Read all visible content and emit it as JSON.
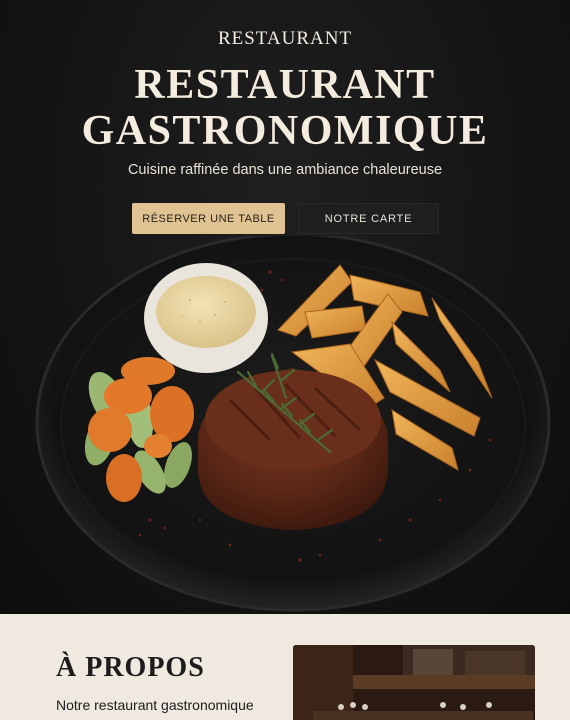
{
  "hero": {
    "brand": "RESTAURANT",
    "title_line1": "RESTAURANT",
    "title_line2": "GASTRONOMIQUE",
    "subtitle": "Cuisine raffinée dans une ambiance chaleureuse",
    "primary_button": "RÉSERVER UNE TABLE",
    "secondary_button": "NOTRE CARTE"
  },
  "about": {
    "title": "À PROPOS",
    "text": "Notre restaurant gastronomique"
  },
  "colors": {
    "hero_bg": "#141414",
    "accent": "#e0c393",
    "cream": "#efe9e0"
  }
}
